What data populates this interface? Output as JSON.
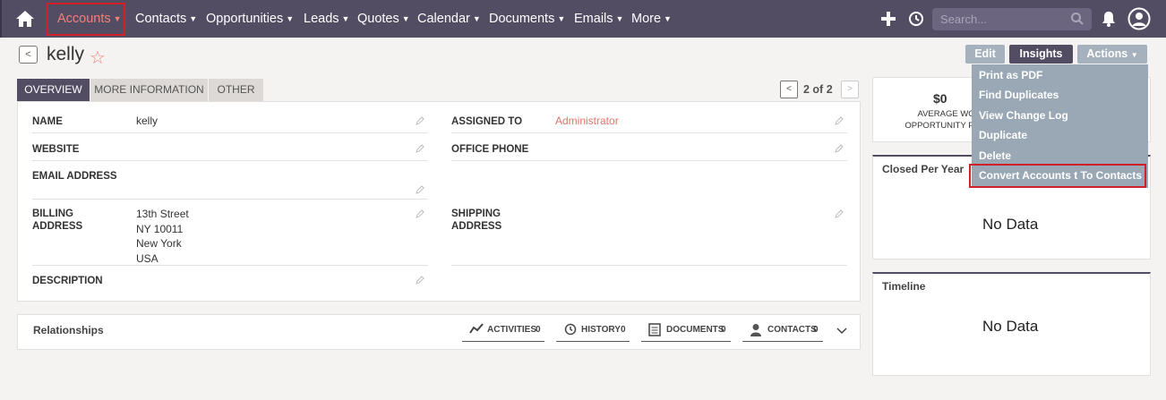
{
  "nav": {
    "items": [
      {
        "label": "Accounts"
      },
      {
        "label": "Contacts"
      },
      {
        "label": "Opportunities"
      },
      {
        "label": "Leads"
      },
      {
        "label": "Quotes"
      },
      {
        "label": "Calendar"
      },
      {
        "label": "Documents"
      },
      {
        "label": "Emails"
      },
      {
        "label": "More"
      }
    ],
    "search_placeholder": "Search...",
    "active_color": "#f08377",
    "bar_color": "#534d64"
  },
  "record": {
    "title": "kelly",
    "buttons": {
      "edit": "Edit",
      "insights": "Insights",
      "actions": "Actions"
    }
  },
  "tabs": [
    "OVERVIEW",
    "MORE INFORMATION",
    "OTHER"
  ],
  "pager": {
    "text": "2 of 2"
  },
  "fields": {
    "name_label": "NAME",
    "name_value": "kelly",
    "assigned_label": "ASSIGNED TO",
    "assigned_value": "Administrator",
    "website_label": "WEBSITE",
    "office_phone_label": "OFFICE PHONE",
    "email_label": "EMAIL ADDRESS",
    "billing_label_1": "BILLING",
    "billing_label_2": "ADDRESS",
    "billing_lines": [
      "13th Street",
      "NY 10011",
      "New York",
      "USA"
    ],
    "shipping_label_1": "SHIPPING",
    "shipping_label_2": "ADDRESS",
    "description_label": "DESCRIPTION"
  },
  "relationships": {
    "title": "Relationships",
    "tabs": [
      {
        "label": "ACTIVITIES",
        "count": "0"
      },
      {
        "label": "HISTORY",
        "count": "0"
      },
      {
        "label": "DOCUMENTS",
        "count": "0"
      },
      {
        "label": "CONTACTS",
        "count": "0"
      }
    ]
  },
  "widgets": {
    "amount": "$0",
    "amount_sub_1": "AVERAGE WON",
    "amount_sub_2": "OPPORTUNITY PER Y",
    "closed_title": "Closed Per Year",
    "closed_nodata": "No Data",
    "timeline_title": "Timeline",
    "timeline_nodata": "No Data"
  },
  "actions_menu": {
    "items": [
      "Print as PDF",
      "Find Duplicates",
      "View Change Log",
      "Duplicate",
      "Delete",
      "Convert Accounts t To Contacts"
    ]
  }
}
